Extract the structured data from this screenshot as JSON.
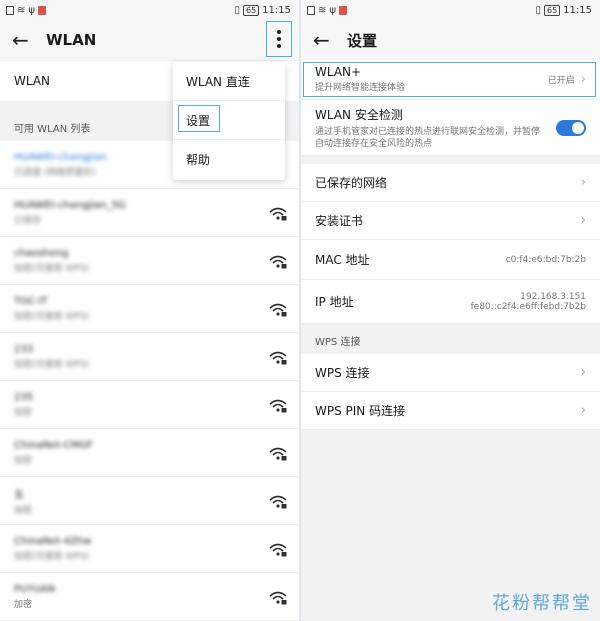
{
  "status": {
    "battery": "65",
    "time": "11:15"
  },
  "left": {
    "title": "WLAN",
    "wlan_toggle_label": "WLAN",
    "section_available": "可用 WLAN 列表",
    "networks": [
      {
        "name": "HUAWEI-changjian",
        "sub": "已连接 (网络质量好)",
        "link": true
      },
      {
        "name": "HUAWEI-changjian_5G",
        "sub": "已保存"
      },
      {
        "name": "chaosheng",
        "sub": "加密(可使用 WPS)"
      },
      {
        "name": "TOC-IT",
        "sub": "加密(可使用 WPS)"
      },
      {
        "name": "233",
        "sub": "加密(可使用 WPS)"
      },
      {
        "name": "235",
        "sub": "加密"
      },
      {
        "name": "ChinaNet-CMGF",
        "sub": "加密"
      },
      {
        "name": "五",
        "sub": "加密"
      },
      {
        "name": "ChinaNet-4Zhw",
        "sub": "加密(可使用 WPS)"
      },
      {
        "name": "PUYUAN",
        "sub": "加密"
      }
    ],
    "menu": {
      "item1": "WLAN 直连",
      "item2": "设置",
      "item3": "帮助"
    }
  },
  "right": {
    "title": "设置",
    "wlanplus": {
      "label": "WLAN+",
      "sub": "提升网络智能连接体验",
      "value": "已开启"
    },
    "security": {
      "label": "WLAN 安全检测",
      "sub": "通过手机管家对已连接的热点进行联网安全检测，并暂停自动连接存在安全风险的热点",
      "enabled": true
    },
    "saved": "已保存的网络",
    "cert": "安装证书",
    "mac": {
      "label": "MAC 地址",
      "value": "c0:f4:e6:bd:7b:2b"
    },
    "ip": {
      "label": "IP 地址",
      "value1": "192.168.3.151",
      "value2": "fe80::c2f4:e6ff:febd:7b2b"
    },
    "wps_section": "WPS 连接",
    "wps": "WPS 连接",
    "wps_pin": "WPS PIN 码连接"
  },
  "watermark": "花粉帮帮堂",
  "colors": {
    "accent": "#2a7cd8",
    "highlight": "#4fb3c8"
  }
}
